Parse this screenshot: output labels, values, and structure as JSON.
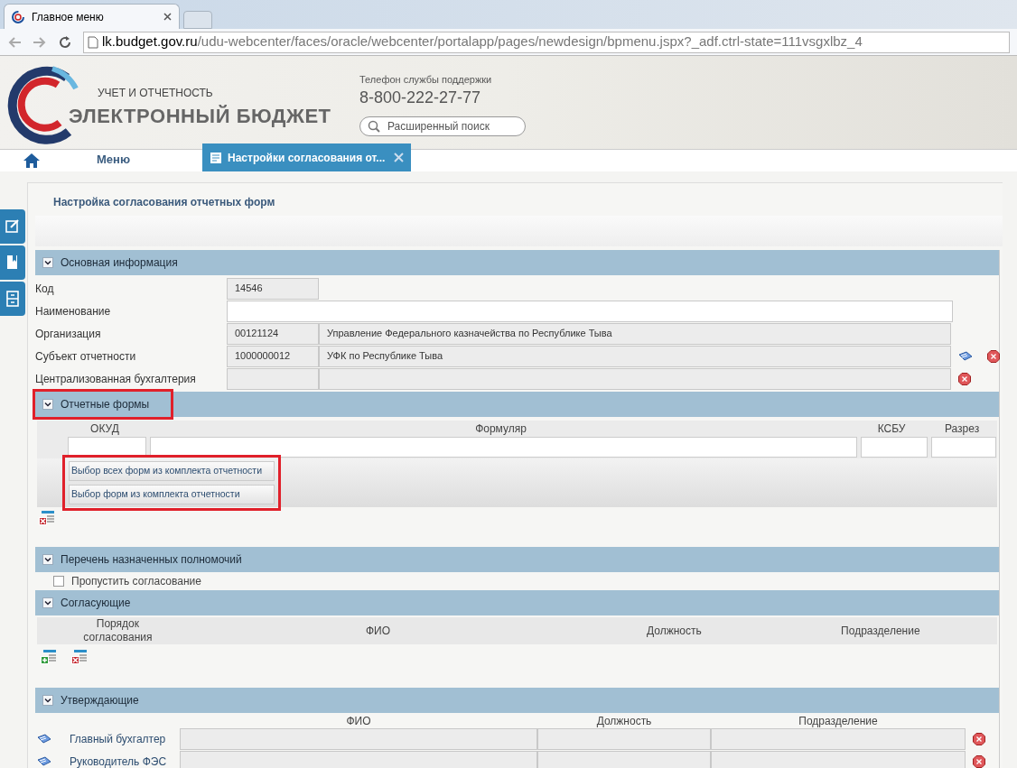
{
  "browser": {
    "tab_title": "Главное меню",
    "url_host": "lk.budget.gov.ru",
    "url_path": "/udu-webcenter/faces/oracle/webcenter/portalapp/pages/newdesign/bpmenu.jspx?_adf.ctrl-state=111vsgxlbz_4"
  },
  "header": {
    "subtitle": "УЧЕТ И ОТЧЕТНОСТЬ",
    "title": "ЭЛЕКТРОННЫЙ БЮДЖЕТ",
    "support_label": "Телефон службы поддержки",
    "phone": "8-800-222-27-77",
    "search_placeholder": "Расширенный поиск"
  },
  "nav": {
    "menu": "Меню",
    "tabs": [
      {
        "label": "Настройки согласования от...",
        "selected": true
      }
    ]
  },
  "page_title": "Настройка согласования отчетных форм",
  "basic": {
    "title": "Основная информация",
    "expanded": true,
    "highlighted": false,
    "fields": [
      {
        "kind": "code",
        "label": "Код",
        "code": "14546"
      },
      {
        "kind": "input",
        "label": "Наименование"
      },
      {
        "kind": "pair",
        "label": "Организация",
        "code": "00121124",
        "name": "Управление Федерального казначейства по Республике Тыва",
        "lookup": false,
        "clear": false
      },
      {
        "kind": "pair",
        "label": "Субъект отчетности",
        "code": "1000000012",
        "name": "УФК по Республике Тыва",
        "lookup": true,
        "clear": true
      },
      {
        "kind": "pair",
        "label": "Централизованная бухгалтерия",
        "lookup": false,
        "clear": true
      }
    ]
  },
  "forms": {
    "title": "Отчетные формы",
    "expanded": true,
    "highlighted": true,
    "columns": [
      "ОКУД",
      "Формуляр",
      "КСБУ",
      "Разрез"
    ],
    "buttons_highlighted": true,
    "buttons": [
      "Выбор всех форм из комплекта отчетности",
      "Выбор форм из комплекта отчетности"
    ]
  },
  "powers": {
    "title": "Перечень назначенных полномочий",
    "expanded": true,
    "highlighted": false,
    "skip": {
      "label": "Пропустить согласование",
      "checked": false
    }
  },
  "approvers": {
    "title": "Согласующие",
    "expanded": true,
    "highlighted": false,
    "columns": [
      "Порядок согласования",
      "ФИО",
      "Должность",
      "Подразделение"
    ]
  },
  "signers": {
    "title": "Утверждающие",
    "expanded": true,
    "highlighted": false,
    "columns": [
      "ФИО",
      "Должность",
      "Подразделение"
    ],
    "rows": [
      {
        "role": "Главный бухгалтер"
      },
      {
        "role": "Руководитель ФЭС"
      }
    ]
  }
}
